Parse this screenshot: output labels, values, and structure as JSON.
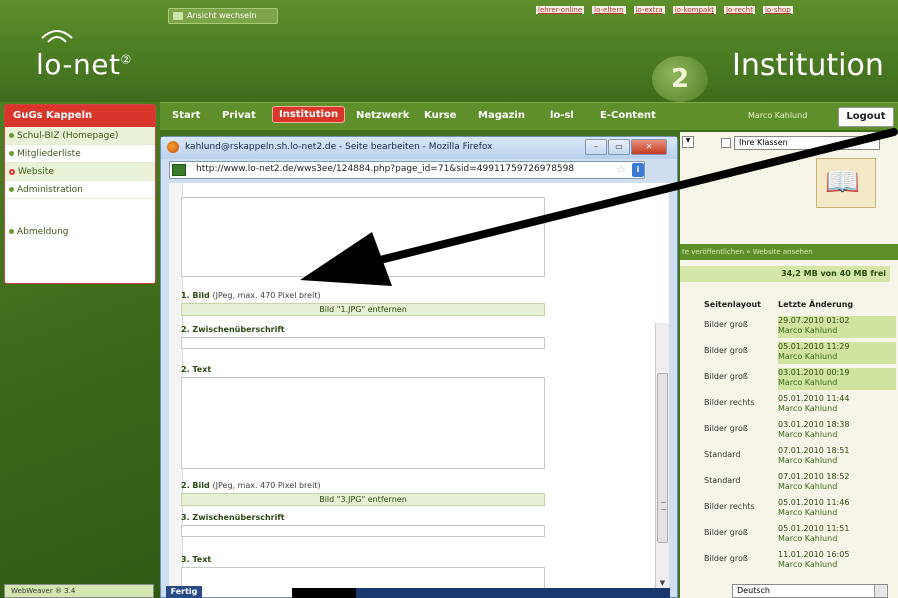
{
  "site": {
    "logo": "lo-net",
    "logo_sup": "②",
    "brand_right": "Institution",
    "badge": "2",
    "switch_label": "Ansicht wechseln",
    "top_links": [
      "lehrer-online",
      "lo-eltern",
      "lo-extra",
      "lo-kompakt",
      "lo-recht",
      "lo-shop"
    ]
  },
  "nav": {
    "items": [
      "Start",
      "Privat",
      "Institution",
      "Netzwerk",
      "Kurse",
      "Magazin",
      "lo-sl",
      "E-Content"
    ],
    "active": "Institution",
    "user": "Marco Kahlund",
    "logout": "Logout"
  },
  "sidebar": {
    "title": "GuGs Kappeln",
    "items": [
      {
        "label": "Schul-BIZ (Homepage)"
      },
      {
        "label": "Mitgliederliste"
      },
      {
        "label": "Website"
      },
      {
        "label": "Administration"
      },
      {
        "label": ""
      },
      {
        "label": "Abmeldung"
      }
    ]
  },
  "browser": {
    "title": "kahlund@rskappeln.sh.lo-net2.de - Seite bearbeiten - Mozilla Firefox",
    "url": "http://www.lo-net2.de/wws3ee/124884.php?page_id=71&sid=49911759726978598",
    "min": "–",
    "max": "▭",
    "close": "✕"
  },
  "form": {
    "bild1_label": "1. Bild",
    "bild1_hint": "(JPeg, max. 470 Pixel breit)",
    "bild1_remove": "Bild \"1.JPG\" entfernen",
    "zwischen2_label": "2. Zwischenüberschrift",
    "text2_label": "2. Text",
    "bild2_label": "2. Bild",
    "bild2_hint": "(JPeg, max. 470 Pixel breit)",
    "bild2_remove": "Bild \"3.JPG\" entfernen",
    "zwischen3_label": "3. Zwischenüberschrift",
    "text3_label": "3. Text"
  },
  "right_panel": {
    "class_select": "Ihre Klassen",
    "actions": "te veröffentlichen  » Website ansehen",
    "storage": "34,2 MB von 40 MB frei",
    "col_layout": "Seitenlayout",
    "col_change": "Letzte Änderung",
    "rows": [
      {
        "layout": "Bilder groß",
        "date": "29.07.2010 01:02",
        "who": "Marco Kahlund"
      },
      {
        "layout": "Bilder groß",
        "date": "05.01.2010 11:29",
        "who": "Marco Kahlund"
      },
      {
        "layout": "Bilder groß",
        "date": "03.01.2010 00:19",
        "who": "Marco Kahlund"
      },
      {
        "layout": "Bilder rechts",
        "date": "05.01.2010 11:44",
        "who": "Marco Kahlund"
      },
      {
        "layout": "Bilder groß",
        "date": "03.01.2010 18:38",
        "who": "Marco Kahlund"
      },
      {
        "layout": "Standard",
        "date": "07.01.2010 18:51",
        "who": "Marco Kahlund"
      },
      {
        "layout": "Standard",
        "date": "07.01.2010 18:52",
        "who": "Marco Kahlund"
      },
      {
        "layout": "Bilder rechts",
        "date": "05.01.2010 11:46",
        "who": "Marco Kahlund"
      },
      {
        "layout": "Bilder groß",
        "date": "05.01.2010 11:51",
        "who": "Marco Kahlund"
      },
      {
        "layout": "Bilder groß",
        "date": "11.01.2010 16:05",
        "who": "Marco Kahlund"
      }
    ],
    "language": "Deutsch"
  },
  "taskbar": {
    "left": "WebWeaver ® 3.4",
    "mid": "Fertig"
  },
  "colors": {
    "brand_green": "#5f8f2b",
    "accent_red": "#d9362b"
  }
}
